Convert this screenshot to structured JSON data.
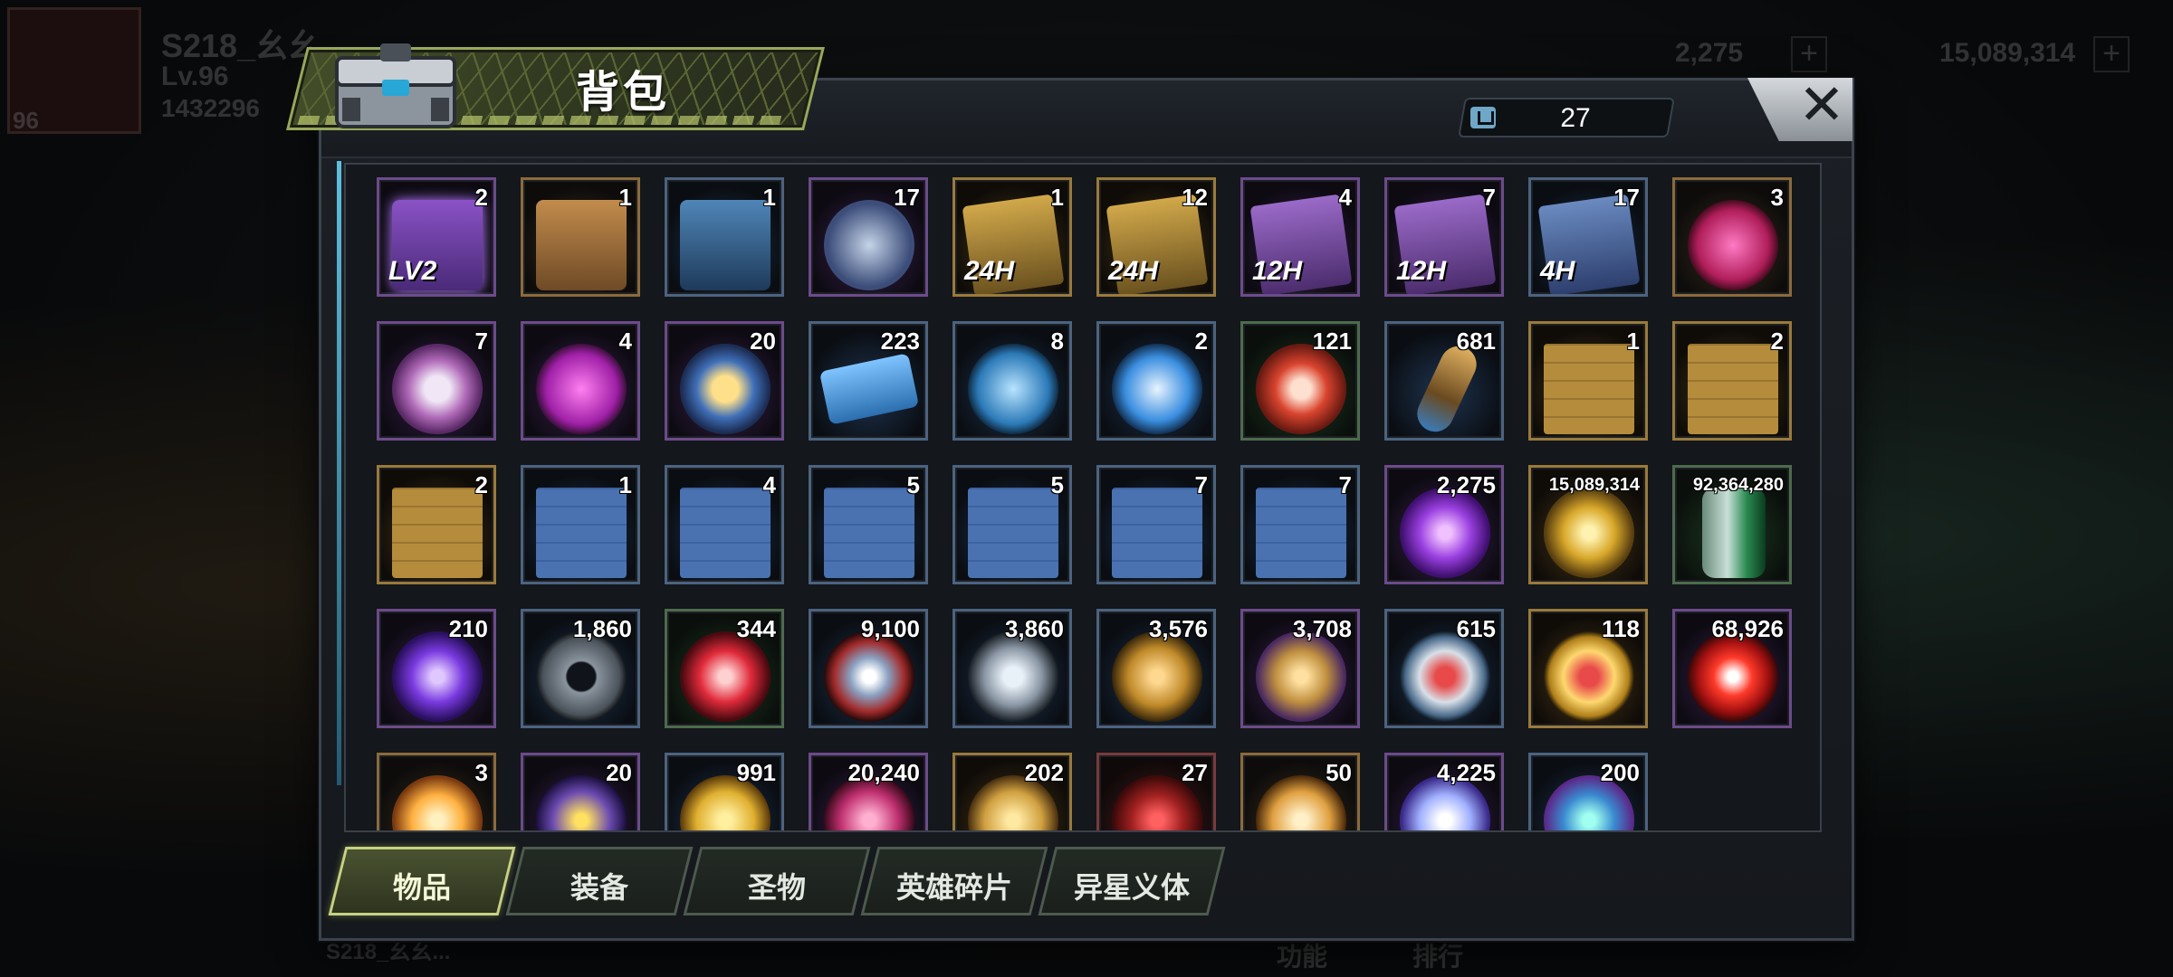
{
  "hud": {
    "server_name": "S218_幺幺...",
    "level": "Lv.96",
    "power": "1432296",
    "avatar_badge": "96",
    "currency_1": "2,275",
    "currency_2": "15,089,314",
    "chat_preview": "S218_幺幺...",
    "bottom_btn_1": "功能",
    "bottom_btn_2": "排行"
  },
  "window": {
    "title": "背包",
    "capacity": "27",
    "close_label": "✕"
  },
  "items": [
    {
      "icon": "purple-chest",
      "count": "2",
      "quality": "purple",
      "label": "LV2"
    },
    {
      "icon": "bronze-chest",
      "count": "1",
      "quality": "orange"
    },
    {
      "icon": "blue-chest",
      "count": "1",
      "quality": "blue"
    },
    {
      "icon": "spring-gadget",
      "count": "17",
      "quality": "purple"
    },
    {
      "icon": "speedup-card-gold",
      "count": "1",
      "quality": "gold",
      "label": "24H"
    },
    {
      "icon": "speedup-card-gold",
      "count": "12",
      "quality": "gold",
      "label": "24H"
    },
    {
      "icon": "speedup-card-purple",
      "count": "4",
      "quality": "purple",
      "label": "12H"
    },
    {
      "icon": "speedup-card-purple",
      "count": "7",
      "quality": "purple",
      "label": "12H"
    },
    {
      "icon": "speedup-card-blue",
      "count": "17",
      "quality": "blue",
      "label": "4H"
    },
    {
      "icon": "red-bottlecap",
      "count": "3",
      "quality": "orange"
    },
    {
      "icon": "film-reel",
      "count": "7",
      "quality": "purple"
    },
    {
      "icon": "pink-bottlecap",
      "count": "4",
      "quality": "purple"
    },
    {
      "icon": "police-badge",
      "count": "20",
      "quality": "purple"
    },
    {
      "icon": "cinema-ticket",
      "count": "223",
      "quality": "blue"
    },
    {
      "icon": "timer-coin",
      "count": "8",
      "quality": "blue"
    },
    {
      "icon": "blue-bottlecap",
      "count": "2",
      "quality": "blue"
    },
    {
      "icon": "poker-chip",
      "count": "121",
      "quality": "green"
    },
    {
      "icon": "bullet",
      "count": "681",
      "quality": "blue"
    },
    {
      "icon": "blueprint-glasses-gold",
      "count": "1",
      "quality": "gold"
    },
    {
      "icon": "blueprint-boots-gold",
      "count": "2",
      "quality": "gold"
    },
    {
      "icon": "blueprint-shirt-gold",
      "count": "2",
      "quality": "gold"
    },
    {
      "icon": "blueprint-shirt-blue",
      "count": "1",
      "quality": "blue"
    },
    {
      "icon": "blueprint-pistol-blue",
      "count": "4",
      "quality": "blue"
    },
    {
      "icon": "blueprint-boots-blue",
      "count": "5",
      "quality": "blue"
    },
    {
      "icon": "blueprint-glasses-blue",
      "count": "5",
      "quality": "blue"
    },
    {
      "icon": "blueprint-swords-blue",
      "count": "7",
      "quality": "blue"
    },
    {
      "icon": "blueprint-hat-blue",
      "count": "7",
      "quality": "blue"
    },
    {
      "icon": "purple-gem",
      "count": "2,275",
      "quality": "purple"
    },
    {
      "icon": "gold-coins",
      "count": "15,089,314",
      "quality": "gold",
      "small": true
    },
    {
      "icon": "green-can",
      "count": "92,364,280",
      "quality": "green",
      "small": true
    },
    {
      "icon": "purple-orb",
      "count": "210",
      "quality": "purple"
    },
    {
      "icon": "gear",
      "count": "1,860",
      "quality": "blue"
    },
    {
      "icon": "red-core",
      "count": "344",
      "quality": "green"
    },
    {
      "icon": "eye-emblem",
      "count": "9,100",
      "quality": "blue"
    },
    {
      "icon": "triangle-shard",
      "count": "3,860",
      "quality": "blue"
    },
    {
      "icon": "gold-fist",
      "count": "3,576",
      "quality": "blue"
    },
    {
      "icon": "puzzle-piece",
      "count": "3,708",
      "quality": "purple"
    },
    {
      "icon": "ship-token",
      "count": "615",
      "quality": "blue"
    },
    {
      "icon": "ship-token-gold",
      "count": "118",
      "quality": "gold"
    },
    {
      "icon": "biohazard-cube",
      "count": "68,926",
      "quality": "purple"
    },
    {
      "icon": "gold-star",
      "count": "3",
      "quality": "orange"
    },
    {
      "icon": "lightning-coin",
      "count": "20",
      "quality": "purple"
    },
    {
      "icon": "yellow-fist",
      "count": "991",
      "quality": "blue"
    },
    {
      "icon": "pink-crystal",
      "count": "20,240",
      "quality": "purple"
    },
    {
      "icon": "gold-medal",
      "count": "202",
      "quality": "gold"
    },
    {
      "icon": "red-target",
      "count": "27",
      "quality": "red"
    },
    {
      "icon": "potion",
      "count": "50",
      "quality": "orange"
    },
    {
      "icon": "white-sphere",
      "count": "4,225",
      "quality": "purple"
    },
    {
      "icon": "dna-helix",
      "count": "200",
      "quality": "blue"
    }
  ],
  "tabs": [
    {
      "label": "物品",
      "active": true
    },
    {
      "label": "装备",
      "active": false
    },
    {
      "label": "圣物",
      "active": false
    },
    {
      "label": "英雄碎片",
      "active": false
    },
    {
      "label": "异星义体",
      "active": false
    }
  ]
}
